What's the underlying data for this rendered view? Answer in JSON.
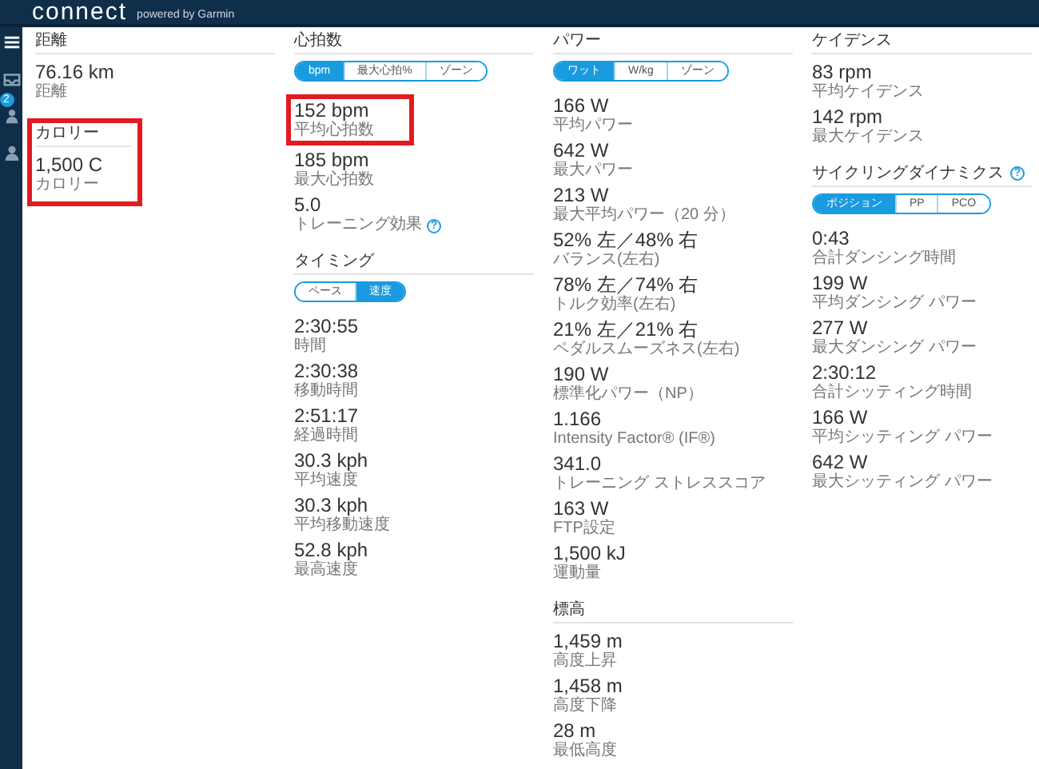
{
  "header": {
    "logo": "connect",
    "tagline": "powered by Garmin"
  },
  "sidebar": {
    "badge": "2"
  },
  "columns": [
    {
      "sections": [
        {
          "title": "距離",
          "highlighted": false,
          "metrics": [
            {
              "value": "76.16 km",
              "label": "距離",
              "highlighted": false
            }
          ]
        },
        {
          "title": "カロリー",
          "highlighted": true,
          "metrics": [
            {
              "value": "1,500 C",
              "label": "カロリー",
              "highlighted": false
            }
          ]
        }
      ]
    },
    {
      "sections": [
        {
          "title": "心拍数",
          "highlighted": false,
          "toggle": [
            {
              "label": "bpm",
              "selected": true
            },
            {
              "label": "最大心拍%",
              "selected": false
            },
            {
              "label": "ゾーン",
              "selected": false
            }
          ],
          "metrics": [
            {
              "value": "152 bpm",
              "label": "平均心拍数",
              "highlighted": true
            },
            {
              "value": "185 bpm",
              "label": "最大心拍数",
              "highlighted": false
            },
            {
              "value": "5.0",
              "label": "トレーニング効果",
              "help_mark": "?",
              "highlighted": false
            }
          ]
        },
        {
          "title": "タイミング",
          "highlighted": false,
          "toggle": [
            {
              "label": "ペース",
              "selected": false
            },
            {
              "label": "速度",
              "selected": true
            }
          ],
          "metrics": [
            {
              "value": "2:30:55",
              "label": "時間",
              "highlighted": false
            },
            {
              "value": "2:30:38",
              "label": "移動時間",
              "highlighted": false
            },
            {
              "value": "2:51:17",
              "label": "経過時間",
              "highlighted": false
            },
            {
              "value": "30.3 kph",
              "label": "平均速度",
              "highlighted": false
            },
            {
              "value": "30.3 kph",
              "label": "平均移動速度",
              "highlighted": false
            },
            {
              "value": "52.8 kph",
              "label": "最高速度",
              "highlighted": false
            }
          ]
        }
      ]
    },
    {
      "sections": [
        {
          "title": "パワー",
          "highlighted": false,
          "toggle": [
            {
              "label": "ワット",
              "selected": true
            },
            {
              "label": "W/kg",
              "selected": false
            },
            {
              "label": "ゾーン",
              "selected": false
            }
          ],
          "metrics": [
            {
              "value": "166 W",
              "label": "平均パワー",
              "highlighted": false
            },
            {
              "value": "642 W",
              "label": "最大パワー",
              "highlighted": false
            },
            {
              "value": "213 W",
              "label": "最大平均パワー（20 分）",
              "highlighted": false
            },
            {
              "value": "52% 左／48% 右",
              "label": "バランス(左右)",
              "highlighted": false
            },
            {
              "value": "78% 左／74% 右",
              "label": "トルク効率(左右)",
              "highlighted": false
            },
            {
              "value": "21% 左／21% 右",
              "label": "ペダルスムーズネス(左右)",
              "highlighted": false
            },
            {
              "value": "190 W",
              "label": "標準化パワー（NP）",
              "highlighted": false
            },
            {
              "value": "1.166",
              "label": "Intensity Factor® (IF®)",
              "highlighted": false
            },
            {
              "value": "341.0",
              "label": "トレーニング ストレススコア",
              "highlighted": false
            },
            {
              "value": "163 W",
              "label": "FTP設定",
              "highlighted": false
            },
            {
              "value": "1,500 kJ",
              "label": "運動量",
              "highlighted": false
            }
          ]
        },
        {
          "title": "標高",
          "highlighted": false,
          "metrics": [
            {
              "value": "1,459 m",
              "label": "高度上昇",
              "highlighted": false
            },
            {
              "value": "1,458 m",
              "label": "高度下降",
              "highlighted": false
            },
            {
              "value": "28 m",
              "label": "最低高度",
              "highlighted": false
            }
          ]
        }
      ]
    },
    {
      "sections": [
        {
          "title": "ケイデンス",
          "highlighted": false,
          "metrics": [
            {
              "value": "83 rpm",
              "label": "平均ケイデンス",
              "highlighted": false
            },
            {
              "value": "142 rpm",
              "label": "最大ケイデンス",
              "highlighted": false
            }
          ]
        },
        {
          "title": "サイクリングダイナミクス",
          "help_mark": "?",
          "highlighted": false,
          "toggle": [
            {
              "label": "ポジション",
              "selected": true
            },
            {
              "label": "PP",
              "selected": false
            },
            {
              "label": "PCO",
              "selected": false
            }
          ],
          "metrics": [
            {
              "value": "0:43",
              "label": "合計ダンシング時間",
              "highlighted": false
            },
            {
              "value": "199 W",
              "label": "平均ダンシング パワー",
              "highlighted": false
            },
            {
              "value": "277 W",
              "label": "最大ダンシング パワー",
              "highlighted": false
            },
            {
              "value": "2:30:12",
              "label": "合計シッティング時間",
              "highlighted": false
            },
            {
              "value": "166 W",
              "label": "平均シッティング パワー",
              "highlighted": false
            },
            {
              "value": "642 W",
              "label": "最大シッティング パワー",
              "highlighted": false
            }
          ]
        }
      ]
    }
  ]
}
